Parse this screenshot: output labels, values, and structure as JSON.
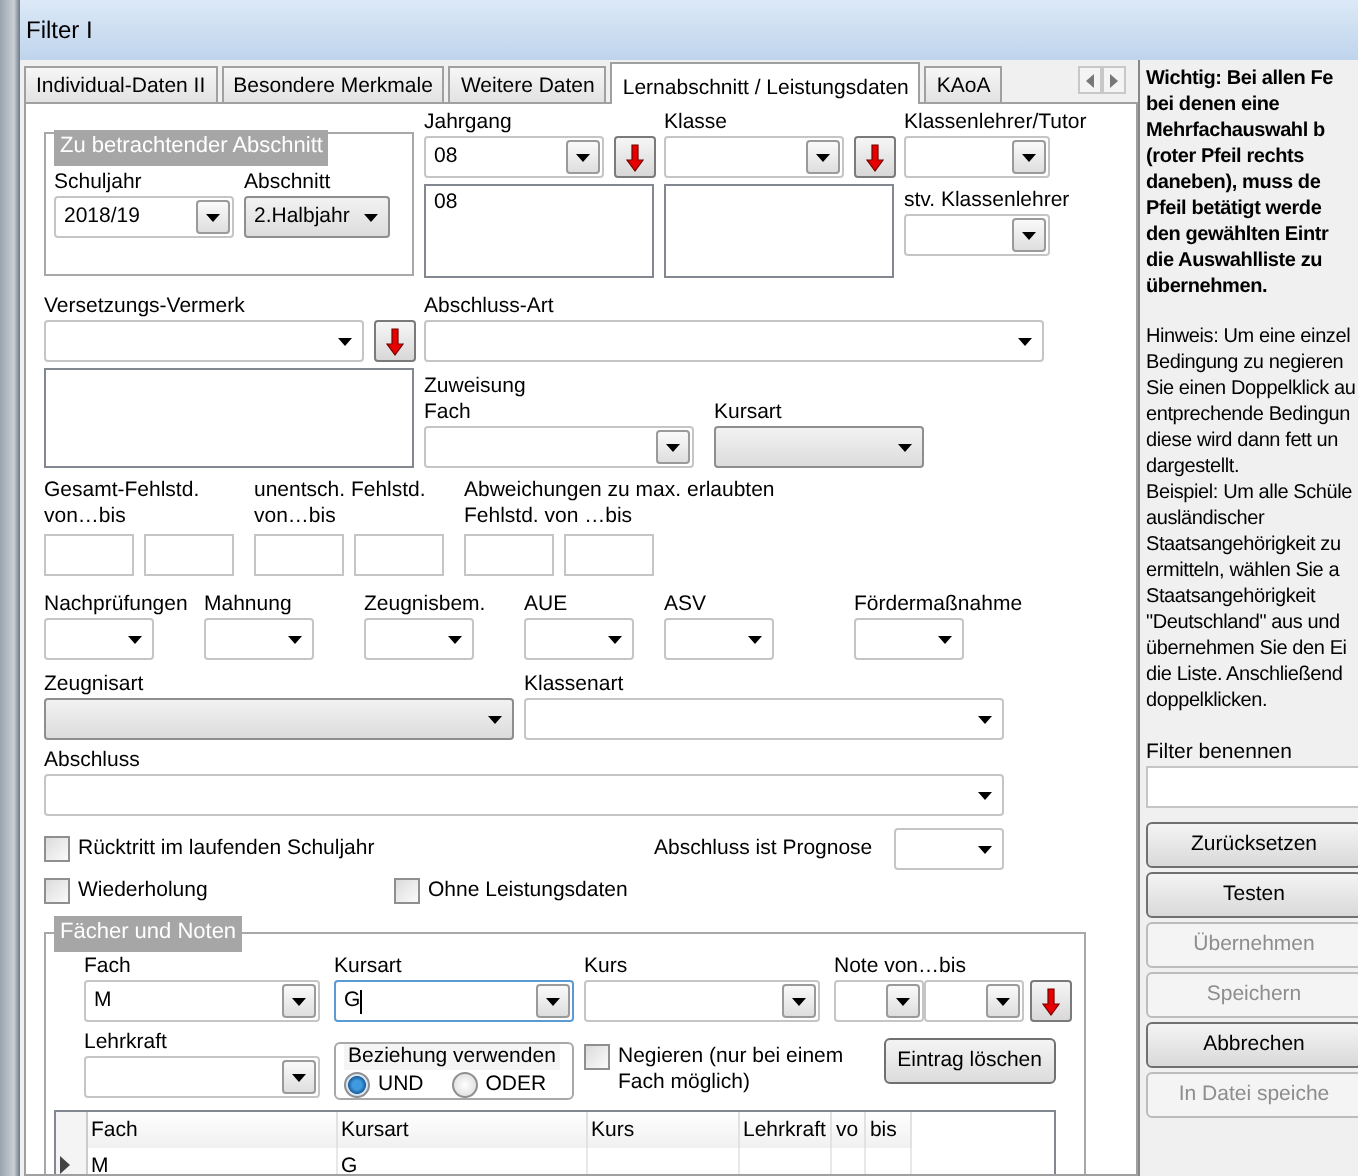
{
  "window": {
    "title": "Filter I"
  },
  "tabs": [
    {
      "label": "Individual-Daten II",
      "selected": false
    },
    {
      "label": "Besondere Merkmale",
      "selected": false
    },
    {
      "label": "Weitere Daten",
      "selected": false
    },
    {
      "label": "Lernabschnitt / Leistungsdaten",
      "selected": true
    },
    {
      "label": "KAoA",
      "selected": false
    }
  ],
  "abschnitt_group": {
    "title": "Zu betrachtender Abschnitt",
    "schuljahr": {
      "label": "Schuljahr",
      "kind": "combo",
      "value": "2018/19"
    },
    "abschnitt": {
      "label": "Abschnitt",
      "kind": "list",
      "value": "2.Halbjahr"
    }
  },
  "jahrgang": {
    "label": "Jahrgang",
    "kind": "combo",
    "value": "08",
    "multi": true,
    "list": [
      "08"
    ]
  },
  "klasse": {
    "label": "Klasse",
    "kind": "combo",
    "multi": true
  },
  "klassenlehrer": {
    "label": "Klassenlehrer/Tutor",
    "kind": "combo"
  },
  "stv_klassenlehrer": {
    "label": "stv. Klassenlehrer",
    "kind": "combo"
  },
  "versetzungs_vermerk": {
    "label": "Versetzungs-Vermerk",
    "kind": "plain",
    "multi": true
  },
  "abschluss_art": {
    "label": "Abschluss-Art",
    "kind": "plain"
  },
  "zuweisung": {
    "title": "Zuweisung",
    "fach": {
      "label": "Fach",
      "kind": "combo"
    },
    "kursart": {
      "label": "Kursart",
      "kind": "list"
    }
  },
  "fehlstunden": [
    {
      "label": "Gesamt-Fehlstd.\nvon…bis"
    },
    {
      "label": "unentsch. Fehlstd.\nvon…bis"
    },
    {
      "label": "Abweichungen zu max. erlaubten\nFehlstd. von …bis"
    }
  ],
  "dropdowns": [
    {
      "label": "Nachprüfungen",
      "kind": "plain"
    },
    {
      "label": "Mahnung",
      "kind": "plain"
    },
    {
      "label": "Zeugnisbem.",
      "kind": "plain"
    },
    {
      "label": "AUE",
      "kind": "plain"
    },
    {
      "label": "ASV",
      "kind": "plain"
    },
    {
      "label": "Fördermaßnahme",
      "kind": "plain"
    }
  ],
  "zeugnisart": {
    "label": "Zeugnisart",
    "kind": "list"
  },
  "klassenart": {
    "label": "Klassenart",
    "kind": "plain"
  },
  "abschluss": {
    "label": "Abschluss",
    "kind": "plain"
  },
  "checkboxes": [
    {
      "label": "Rücktritt im laufenden Schuljahr",
      "checked": false
    },
    {
      "label": "Wiederholung",
      "checked": false
    },
    {
      "label": "Ohne Leistungsdaten",
      "checked": false
    }
  ],
  "abschluss_prognose": {
    "label": "Abschluss ist Prognose",
    "kind": "plain"
  },
  "faecher": {
    "title": "Fächer und Noten",
    "fach": {
      "label": "Fach",
      "kind": "combo",
      "value": "M"
    },
    "kursart": {
      "label": "Kursart",
      "kind": "combo",
      "value": "G",
      "focused": true
    },
    "kurs": {
      "label": "Kurs",
      "kind": "combo"
    },
    "note": {
      "label": "Note von…bis",
      "von": {
        "kind": "combo"
      },
      "bis": {
        "kind": "combo"
      },
      "multi": true
    },
    "lehrkraft": {
      "label": "Lehrkraft",
      "kind": "combo"
    },
    "beziehung": {
      "title": "Beziehung verwenden",
      "options": [
        {
          "label": "UND",
          "selected": true
        },
        {
          "label": "ODER",
          "selected": false
        }
      ]
    },
    "negieren": {
      "label": "Negieren (nur bei einem Fach möglich)",
      "checked": false
    },
    "delete_button": "Eintrag löschen",
    "grid": {
      "columns": [
        "Fach",
        "Kursart",
        "Kurs",
        "Lehrkraft",
        "vo",
        "bis"
      ],
      "rows": [
        {
          "current": true,
          "cells": [
            "M",
            "G"
          ]
        }
      ]
    }
  },
  "help": {
    "important": [
      "Wichtig: Bei allen Fe",
      "bei denen eine",
      "Mehrfachauswahl b",
      "(roter Pfeil rechts",
      "daneben), muss de",
      "Pfeil betätigt werde",
      "den gewählten Eintr",
      "die Auswahlliste zu",
      "übernehmen."
    ],
    "hint": [
      "Hinweis: Um eine einzel",
      "Bedingung zu negieren",
      "Sie einen Doppelklick au",
      "entprechende Bedingun",
      "diese wird dann fett un",
      "dargestellt.",
      "Beispiel: Um alle Schüle",
      "ausländischer",
      "Staatsangehörigkeit zu",
      "ermitteln, wählen Sie a",
      "Staatsangehörigkeit",
      "\"Deutschland\" aus und",
      "übernehmen Sie den Ei",
      "die Liste. Anschließend",
      "doppelklicken."
    ]
  },
  "filter_name": {
    "label": "Filter benennen"
  },
  "buttons": [
    {
      "label": "Zurücksetzen",
      "disabled": false
    },
    {
      "label": "Testen",
      "disabled": false
    },
    {
      "label": "Übernehmen",
      "disabled": true
    },
    {
      "label": "Speichern",
      "disabled": true
    },
    {
      "label": "Abbrechen",
      "disabled": false
    },
    {
      "label": "In Datei speiche",
      "disabled": true
    }
  ]
}
